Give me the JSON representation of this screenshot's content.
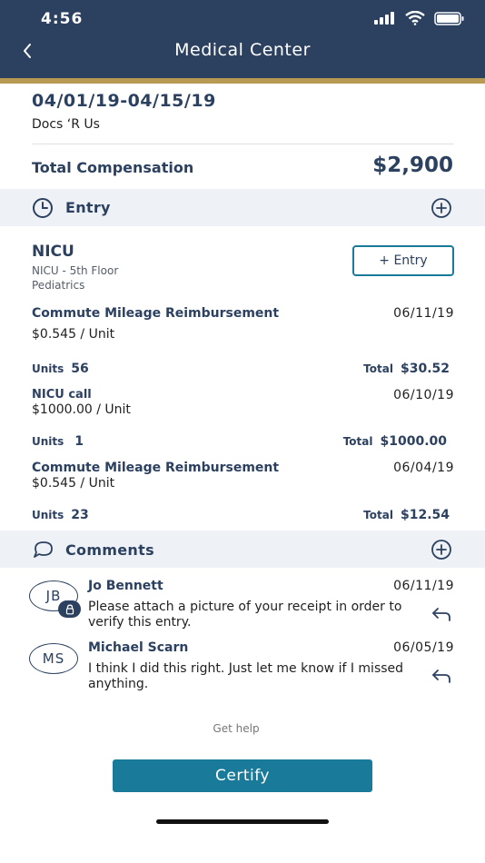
{
  "status_bar": {
    "time": "4:56"
  },
  "header": {
    "title": "Medical Center"
  },
  "summary": {
    "period": "04/01/19-04/15/19",
    "provider": "Docs ‘R Us",
    "total_label": "Total Compensation",
    "total_value": "$2,900"
  },
  "entry_section": {
    "title": "Entry",
    "group": {
      "name": "NICU",
      "location": "NICU - 5th Floor",
      "department": "Pediatrics",
      "add_button": "+ Entry"
    },
    "items": [
      {
        "name": "Commute Mileage Reimbursement",
        "date": "06/11/19",
        "rate": "$0.545 / Unit",
        "units_label": "Units",
        "units": "56",
        "total_label": "Total",
        "total": "$30.52"
      },
      {
        "name": "NICU call",
        "date": "06/10/19",
        "rate": "$1000.00 / Unit",
        "units_label": "Units",
        "units": "1",
        "total_label": "Total",
        "total": "$1000.00"
      },
      {
        "name": "Commute Mileage Reimbursement",
        "date": "06/04/19",
        "rate": "$0.545 / Unit",
        "units_label": "Units",
        "units": "23",
        "total_label": "Total",
        "total": "$12.54"
      }
    ]
  },
  "comments_section": {
    "title": "Comments",
    "comments": [
      {
        "initials": "JB",
        "author": "Jo Bennett",
        "date": "06/11/19",
        "text": "Please attach a picture of your receipt in order to verify this entry.",
        "locked": true
      },
      {
        "initials": "MS",
        "author": "Michael Scarn",
        "date": "06/05/19",
        "text": "I think I did this right. Just let me know if I missed anything.",
        "locked": false
      }
    ]
  },
  "footer": {
    "help": "Get help",
    "certify": "Certify"
  },
  "colors": {
    "navy": "#2c4060",
    "gold": "#b89a55",
    "teal": "#1a7a99",
    "section_bg": "#eef2f6"
  }
}
